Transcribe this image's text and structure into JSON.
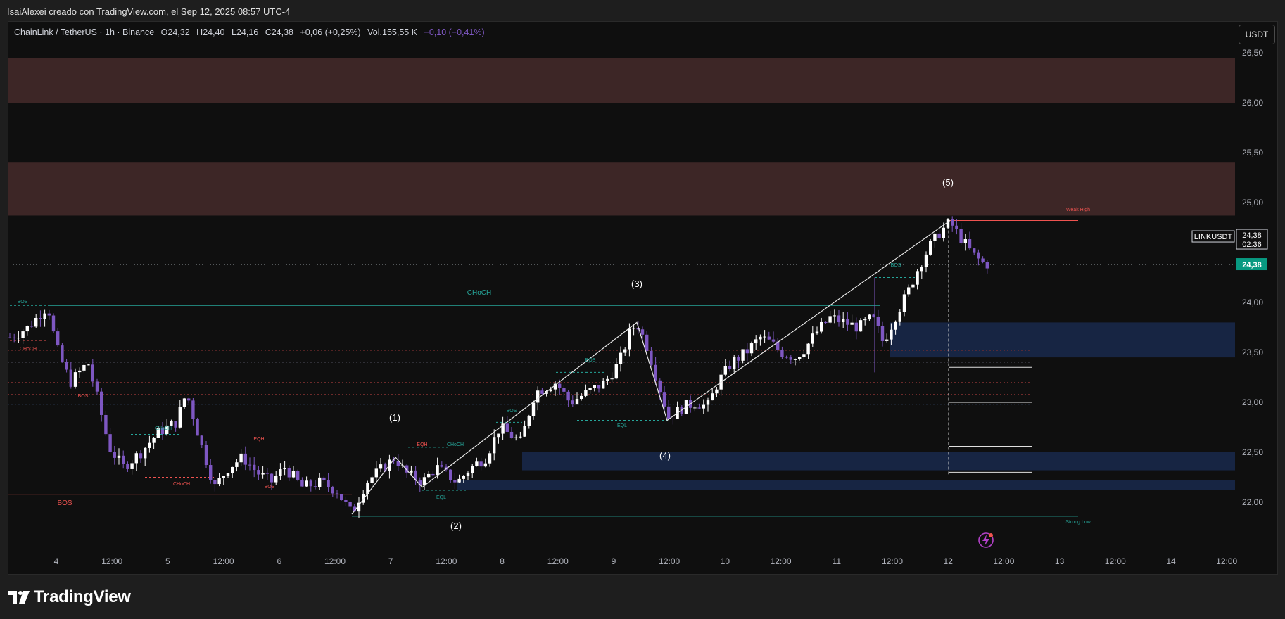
{
  "header": {
    "author_line": "IsaiAlexei creado con TradingView.com, el Sep 12, 2025 08:57 UTC-4"
  },
  "legend": {
    "symbol": "ChainLink / TetherUS · 1h · Binance",
    "open": "O24,32",
    "high": "H24,40",
    "low": "L24,16",
    "close": "C24,38",
    "change": "+0,06 (+0,25%)",
    "volume": "Vol.155,55 K",
    "indicator": "−0,10 (−0,41%)"
  },
  "currency_button": "USDT",
  "price_axis": {
    "ticks": [
      "26,50",
      "26,00",
      "25,50",
      "25,00",
      "24,00",
      "23,50",
      "23,00",
      "22,50",
      "22,00"
    ],
    "symbol_label": "LINKUSDT",
    "last_price": "24,38",
    "countdown": "02:36",
    "current_badge": "24,38"
  },
  "time_axis": {
    "ticks": [
      "4",
      "12:00",
      "5",
      "12:00",
      "6",
      "12:00",
      "7",
      "12:00",
      "8",
      "12:00",
      "9",
      "12:00",
      "10",
      "12:00",
      "11",
      "12:00",
      "12",
      "12:00",
      "13",
      "12:00",
      "14",
      "12:00"
    ]
  },
  "annotations": {
    "wave1": "(1)",
    "wave2": "(2)",
    "wave3": "(3)",
    "wave4": "(4)",
    "wave5": "(5)",
    "choch_main": "CHoCH",
    "bos_left_top": "BOS",
    "choch_left": "CHoCH",
    "bos_red_left": "BOS",
    "bos_red_big": "BOS",
    "choch_green_mid": "CHoCH",
    "choch_red_mid": "CHoCH",
    "eqh_1": "EQH",
    "bos_red_mid": "BOS",
    "eqh_2": "EQH",
    "choch_green_2": "CHoCH",
    "eql_1": "EQL",
    "bos_green_1": "BOS",
    "bos_green_2": "BOS",
    "eql_2": "EQL",
    "bos_green_3": "BOS",
    "weak_high": "Weak High",
    "strong_low": "Strong Low"
  },
  "chart_data": {
    "type": "candlestick",
    "symbol": "ChainLink / TetherUS",
    "ylim": [
      21.5,
      26.6
    ],
    "x_categories": [
      "4",
      "12:00",
      "5",
      "12:00",
      "6",
      "12:00",
      "7",
      "12:00",
      "8",
      "12:00",
      "9",
      "12:00",
      "10",
      "12:00",
      "11",
      "12:00",
      "12",
      "12:00",
      "13",
      "12:00",
      "14",
      "12:00"
    ],
    "key_points": [
      {
        "label": "(1)",
        "price": 22.45
      },
      {
        "label": "(2)",
        "price": 21.85
      },
      {
        "label": "(3)",
        "price": 23.8
      },
      {
        "label": "(4)",
        "price": 22.82
      },
      {
        "label": "(5)",
        "price": 24.8
      }
    ],
    "zones": [
      {
        "kind": "supply",
        "from": 26.0,
        "to": 26.45
      },
      {
        "kind": "supply",
        "from": 24.87,
        "to": 25.4
      },
      {
        "kind": "demand",
        "from": 23.45,
        "to": 23.8
      },
      {
        "kind": "demand",
        "from": 22.32,
        "to": 22.5
      },
      {
        "kind": "demand",
        "from": 22.12,
        "to": 22.22
      }
    ],
    "levels": [
      {
        "label": "Weak High",
        "price": 24.82
      },
      {
        "label": "Strong Low",
        "price": 21.86
      },
      {
        "label": "CHoCH",
        "price": 23.97
      },
      {
        "label": "BOS",
        "price": 22.08
      }
    ],
    "last_price": 24.38,
    "colors": {
      "up": "#ffffff",
      "down": "#7e57c2",
      "accent": "#26a69a",
      "bear": "#ef5350"
    }
  }
}
